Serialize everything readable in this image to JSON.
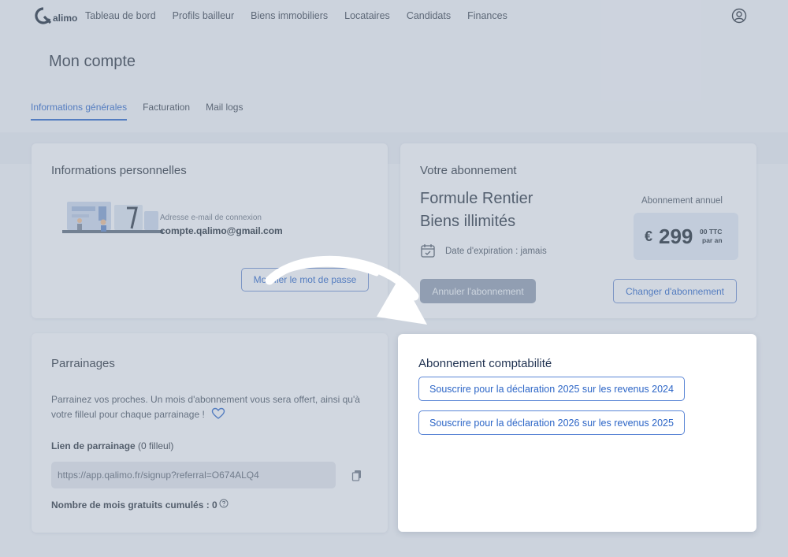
{
  "nav": {
    "logo_text": "alimo",
    "links": [
      "Tableau de bord",
      "Profils bailleur",
      "Biens immobiliers",
      "Locataires",
      "Candidats",
      "Finances"
    ]
  },
  "page": {
    "title": "Mon compte"
  },
  "tabs": [
    {
      "label": "Informations générales",
      "active": true
    },
    {
      "label": "Facturation",
      "active": false
    },
    {
      "label": "Mail logs",
      "active": false
    }
  ],
  "personal": {
    "title": "Informations personnelles",
    "email_label": "Adresse e-mail de connexion",
    "email": "compte.qalimo@gmail.com",
    "button": "Modifier le mot de passe"
  },
  "subscription": {
    "title": "Votre abonnement",
    "plan_line1": "Formule Rentier",
    "plan_line2": "Biens illimités",
    "expiration": "Date d'expiration : jamais",
    "annual_label": "Abonnement annuel",
    "currency": "€",
    "price": "299",
    "price_cents": "00 TTC",
    "price_period": "par an",
    "cancel_button": "Annuler l'abonnement",
    "change_button": "Changer d'abonnement"
  },
  "referral": {
    "title": "Parrainages",
    "description": "Parrainez vos proches. Un mois d'abonnement vous sera offert, ainsi qu'à votre filleul pour chaque parrainage !",
    "link_label": "Lien de parrainage",
    "link_count": "(0 filleul)",
    "link_value": "https://app.qalimo.fr/signup?referral=O674ALQ4",
    "months_label": "Nombre de mois gratuits cumulés : 0"
  },
  "accounting": {
    "title": "Abonnement comptabilité",
    "button_2025": "Souscrire pour la déclaration 2025 sur les revenus 2024",
    "button_2026": "Souscrire pour la déclaration 2026 sur les revenus 2025"
  },
  "colors": {
    "accent": "#2d66c7",
    "overlay": "#96a2b6",
    "highlight_card": "#ffffff"
  }
}
